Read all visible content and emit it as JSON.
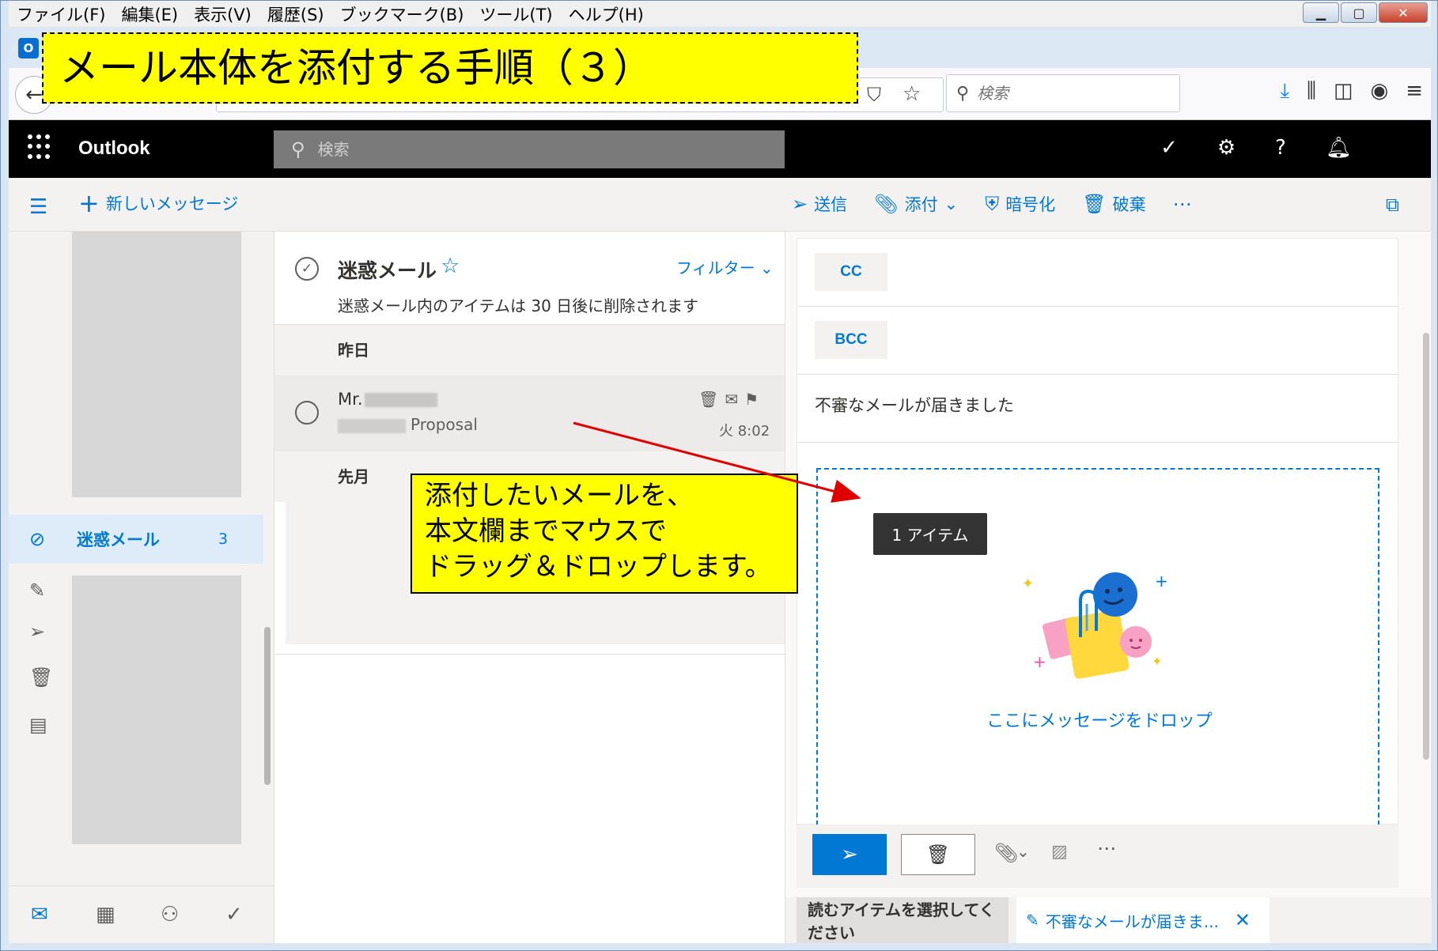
{
  "browser": {
    "menu": [
      "ファイル(F)",
      "編集(E)",
      "表示(V)",
      "履歴(S)",
      "ブックマーク(B)",
      "ツール(T)",
      "ヘルプ(H)"
    ],
    "search_placeholder": "検索"
  },
  "annotation": {
    "title": "メール本体を添付する手順（３）",
    "instruction_lines": [
      "添付したいメールを、",
      "本文欄までマウスで",
      "ドラッグ＆ドロップします。"
    ]
  },
  "outlook": {
    "app_name": "Outlook",
    "search_placeholder": "検索",
    "new_message": "新しいメッセージ",
    "commands": {
      "send": "送信",
      "attach": "添付",
      "encrypt": "暗号化",
      "discard": "破棄"
    },
    "folder": {
      "name": "迷惑メール",
      "count": "3"
    },
    "list": {
      "title": "迷惑メール",
      "filter": "フィルター",
      "notice": "迷惑メール内のアイテムは 30 日後に削除されます",
      "group_yesterday": "昨日",
      "group_lastmonth": "先月",
      "message": {
        "sender_prefix": "Mr.",
        "subject_suffix": "Proposal",
        "time": "火 8:02"
      }
    },
    "compose": {
      "cc_label": "CC",
      "bcc_label": "BCC",
      "subject": "不審なメールが届きました",
      "drop_text": "ここにメッセージをドロップ",
      "drag_tooltip": "1 アイテム"
    },
    "tabs": {
      "reading": "読むアイテムを選択してください",
      "draft": "不審なメールが届きま..."
    }
  }
}
